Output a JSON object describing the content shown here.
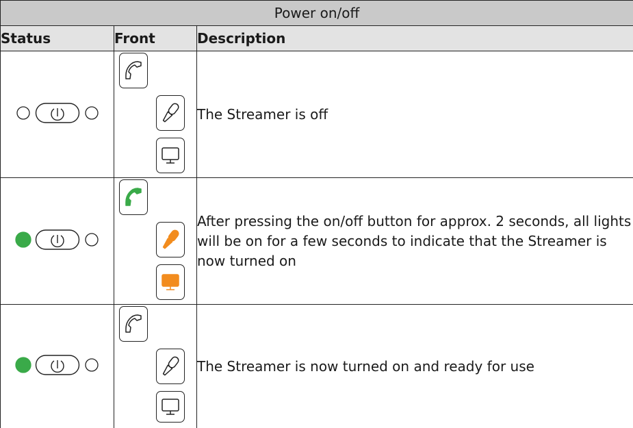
{
  "table": {
    "title": "Power on/off",
    "headers": [
      "Status",
      "Front",
      "Description"
    ],
    "rows": [
      {
        "left_light": "off",
        "right_light": "off",
        "front": {
          "phone": "off",
          "mic": "off",
          "screen": "off"
        },
        "description": "The Streamer is off"
      },
      {
        "left_light": "green",
        "right_light": "off",
        "front": {
          "phone": "green",
          "mic": "orange",
          "screen": "orange"
        },
        "description": "After pressing the on/off button for approx. 2 seconds, all lights will be on for a few seconds to indicate that the Streamer is now turned on"
      },
      {
        "left_light": "green",
        "right_light": "off",
        "front": {
          "phone": "off",
          "mic": "off",
          "screen": "off"
        },
        "description": "The Streamer is now turned on and ready for use"
      }
    ]
  },
  "colors": {
    "title_bg": "#c9c9c9",
    "header_bg": "#e3e3e3",
    "led_green": "#3aaa49",
    "led_orange": "#f28c1e",
    "outline": "#222222"
  },
  "icons": {
    "power_button": "power-button-icon",
    "phone": "phone-icon",
    "mic": "microphone-icon",
    "screen": "monitor-icon"
  }
}
